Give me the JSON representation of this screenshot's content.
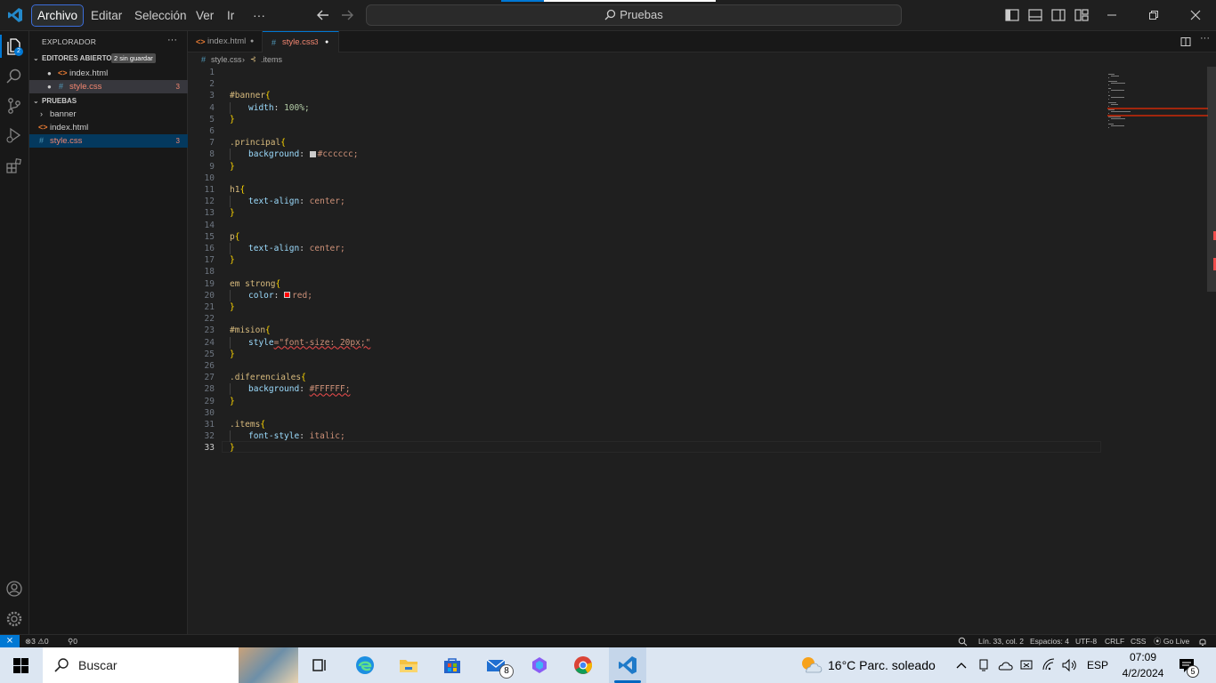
{
  "titlebar": {
    "menus": [
      "Archivo",
      "Editar",
      "Selección",
      "Ver",
      "Ir"
    ],
    "more": "···",
    "command_center": "Pruebas"
  },
  "sidebar": {
    "title": "EXPLORADOR",
    "more": "···",
    "open_editors": {
      "label": "EDITORES ABIERTOS",
      "badge": "2 sin guardar"
    },
    "open_files": [
      {
        "name": "index.html",
        "icon": "html-file-icon"
      },
      {
        "name": "style.css",
        "icon": "css-file-icon",
        "problems": "3"
      }
    ],
    "project": {
      "label": "PRUEBAS"
    },
    "tree": [
      {
        "name": "banner",
        "type": "folder"
      },
      {
        "name": "index.html",
        "type": "html"
      },
      {
        "name": "style.css",
        "type": "css",
        "problems": "3"
      }
    ]
  },
  "tabs": [
    {
      "name": "index.html",
      "modified": "●"
    },
    {
      "name": "style.css",
      "problems": "3",
      "modified": "●"
    }
  ],
  "breadcrumb": {
    "file": "style.css",
    "symbol": ".items"
  },
  "code_lines": [
    {
      "n": "1",
      "t": ""
    },
    {
      "n": "2",
      "t": ""
    },
    {
      "n": "3",
      "sel": "#banner",
      "brace": "{"
    },
    {
      "n": "4",
      "prop": "width",
      "val": "100%;",
      "indent": true
    },
    {
      "n": "5",
      "brace": "}"
    },
    {
      "n": "6",
      "t": ""
    },
    {
      "n": "7",
      "sel": ".principal",
      "brace": "{"
    },
    {
      "n": "8",
      "prop": "background",
      "swatch": "#cccccc",
      "val": "#cccccc;",
      "indent": true
    },
    {
      "n": "9",
      "brace": "}"
    },
    {
      "n": "10",
      "t": ""
    },
    {
      "n": "11",
      "sel": "h1",
      "brace": "{"
    },
    {
      "n": "12",
      "prop": "text-align",
      "val": "center;",
      "indent": true
    },
    {
      "n": "13",
      "brace": "}"
    },
    {
      "n": "14",
      "t": ""
    },
    {
      "n": "15",
      "sel": "p",
      "brace": "{"
    },
    {
      "n": "16",
      "prop": "text-align",
      "val": "center;",
      "indent": true
    },
    {
      "n": "17",
      "brace": "}"
    },
    {
      "n": "18",
      "t": ""
    },
    {
      "n": "19",
      "sel": "em strong",
      "brace": "{"
    },
    {
      "n": "20",
      "prop": "color",
      "swatch": "#ff0000",
      "val": "red;",
      "indent": true
    },
    {
      "n": "21",
      "brace": "}"
    },
    {
      "n": "22",
      "t": ""
    },
    {
      "n": "23",
      "sel": "#mision",
      "brace": "{"
    },
    {
      "n": "24",
      "prop": "style",
      "raw": "=\"font-size: 20px;\"",
      "indent": true
    },
    {
      "n": "25",
      "brace": "}"
    },
    {
      "n": "26",
      "t": ""
    },
    {
      "n": "27",
      "sel": ".diferenciales",
      "brace": "{"
    },
    {
      "n": "28",
      "prop": "background",
      "val": "#FFFFFF;",
      "indent": true
    },
    {
      "n": "29",
      "brace": "}"
    },
    {
      "n": "30",
      "t": ""
    },
    {
      "n": "31",
      "sel": ".items",
      "brace": "{"
    },
    {
      "n": "32",
      "prop": "font-style",
      "val": "italic;",
      "indent": true
    },
    {
      "n": "33",
      "brace": "}"
    }
  ],
  "status": {
    "remote_icon": "remote-icon",
    "errors": "3",
    "warnings": "0",
    "ports": "0",
    "position": "Lín. 33, col. 2",
    "spaces": "Espacios: 4",
    "encoding": "UTF-8",
    "eol": "CRLF",
    "language": "CSS",
    "golive": "Go Live"
  },
  "taskbar": {
    "search": "Buscar",
    "weather": "16°C  Parc. soleado",
    "lang": "ESP",
    "time": "07:09",
    "date": "4/2/2024",
    "mail_badge": "8",
    "notif_badge": "5"
  },
  "colors": {
    "accent": "#0078d4",
    "selector": "#d7ba7d",
    "property": "#9cdcfe",
    "value": "#ce9178",
    "number": "#b5cea8",
    "brace": "#ffd700",
    "error": "#f48771"
  }
}
